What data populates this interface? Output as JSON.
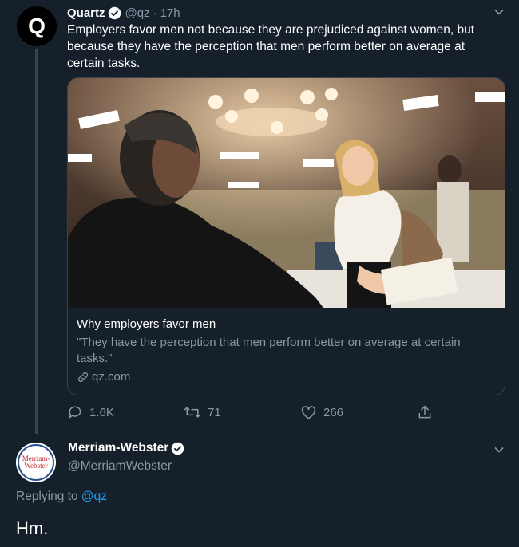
{
  "tweet1": {
    "avatar_letter": "Q",
    "name": "Quartz",
    "handle": "@qz",
    "separator": "·",
    "time": "17h",
    "text": "Employers favor men not because they are prejudiced against women, but because they have the perception that men perform better on average at certain tasks.",
    "card": {
      "title": "Why employers favor men",
      "description": "\"They have the perception that men perform better on average at certain tasks.\"",
      "domain": "qz.com"
    },
    "actions": {
      "replies": "1.6K",
      "retweets": "71",
      "likes": "266"
    }
  },
  "tweet2": {
    "avatar_text_line1": "Merriam-",
    "avatar_text_line2": "Webster",
    "name": "Merriam-Webster",
    "handle": "@MerriamWebster",
    "replying_prefix": "Replying to",
    "replying_to": "@qz",
    "text": "Hm."
  },
  "colors": {
    "background": "#15202b",
    "muted": "#8899a6",
    "accent": "#1da1f2"
  }
}
